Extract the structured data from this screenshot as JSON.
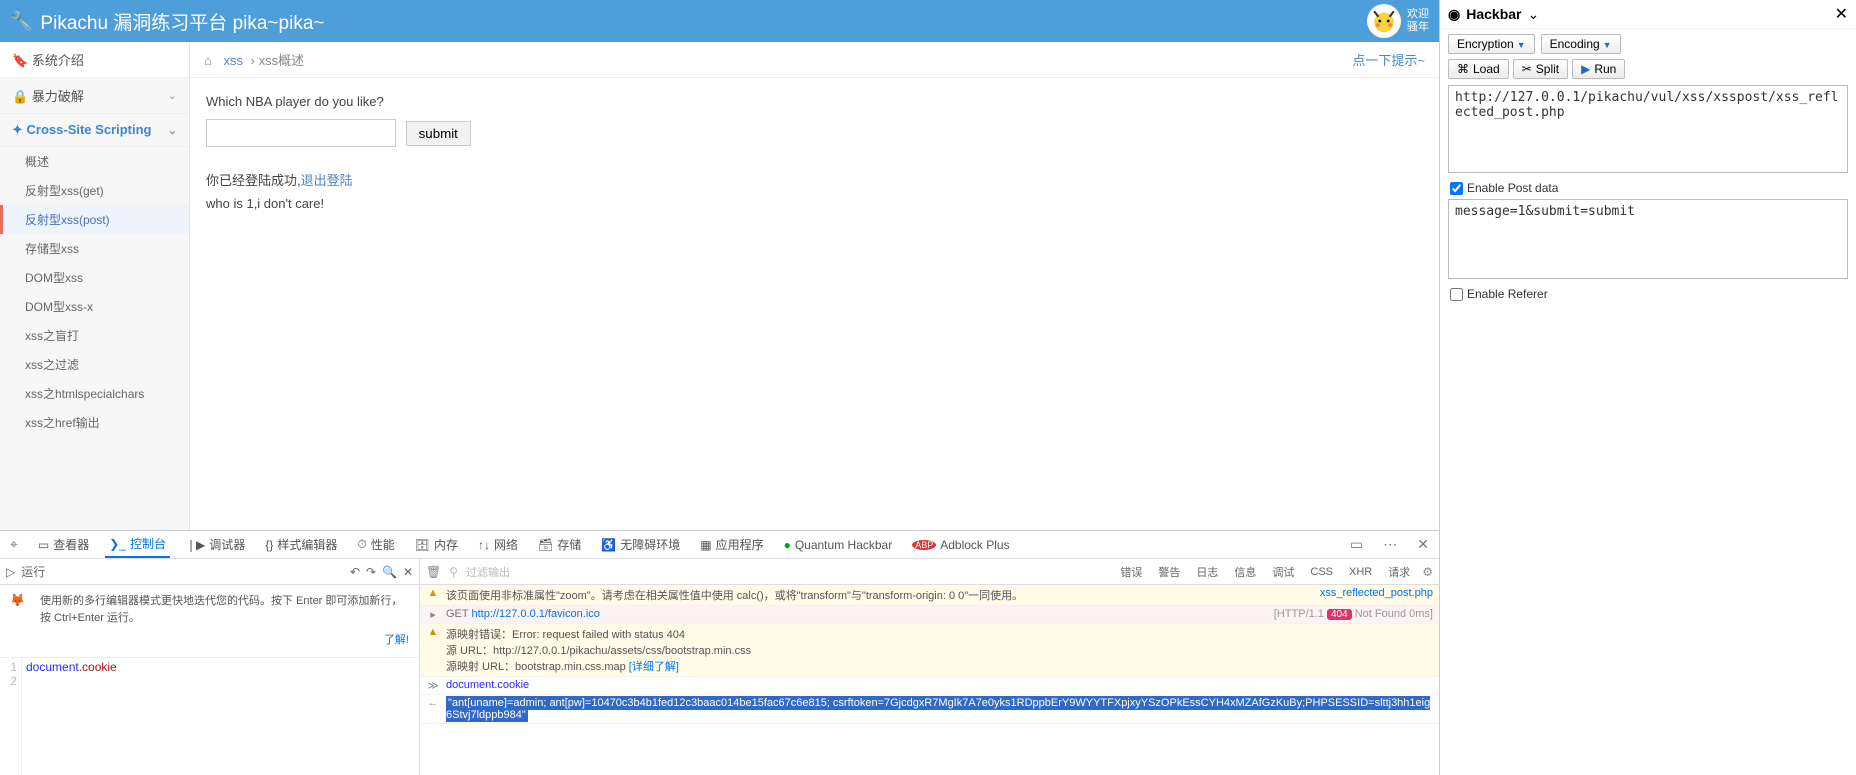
{
  "header": {
    "title": "Pikachu 漏洞练习平台 pika~pika~",
    "welcome_line1": "欢迎",
    "welcome_line2": "骚年"
  },
  "sidebar": {
    "intro": "系统介绍",
    "brute": "暴力破解",
    "xss_group": "Cross-Site Scripting",
    "items": [
      "概述",
      "反射型xss(get)",
      "反射型xss(post)",
      "存储型xss",
      "DOM型xss",
      "DOM型xss-x",
      "xss之盲打",
      "xss之过滤",
      "xss之htmlspecialchars",
      "xss之href输出"
    ]
  },
  "breadcrumb": {
    "root": "xss",
    "sep": "›",
    "leaf": "xss概述",
    "hint": "点一下提示~"
  },
  "content": {
    "question": "Which NBA player do you like?",
    "submit": "submit",
    "logged_prefix": "你已经登陆成功,",
    "logout_link": "退出登陆",
    "result_line": "who is 1,i don't care!"
  },
  "devtools": {
    "tabs": {
      "inspector": "查看器",
      "console": "控制台",
      "debugger": "调试器",
      "style": "样式编辑器",
      "perf": "性能",
      "memory": "内存",
      "network": "网络",
      "storage": "存储",
      "a11y": "无障碍环境",
      "app": "应用程序",
      "quantum": "Quantum Hackbar",
      "abp": "Adblock Plus"
    },
    "run_label": "运行",
    "editor_hint": "使用新的多行编辑器模式更快地迭代您的代码。按下 Enter 即可添加新行，按 Ctrl+Enter 运行。",
    "learn": "了解!",
    "editor_code_doc": "document",
    "editor_code_cookie": ".cookie",
    "filter_placeholder": "过滤输出",
    "pills": [
      "错误",
      "警告",
      "日志",
      "信息",
      "调试",
      "CSS",
      "XHR",
      "请求"
    ],
    "rows": {
      "warn1": "该页面使用非标准属性\"zoom\"。请考虑在相关属性值中使用 calc()，或将\"transform\"与\"transform-origin: 0 0\"一同使用。",
      "warn1_src": "xss_reflected_post.php",
      "err_prefix": "GET ",
      "err_url": "http://127.0.0.1/favicon.ico",
      "err_status_pre": "[HTTP/1.1 ",
      "err_code": "404",
      "err_status_post": " Not Found 0ms]",
      "warn2_l1": "源映射错误：Error: request failed with status 404",
      "warn2_l2": "源 URL：http://127.0.0.1/pikachu/assets/css/bootstrap.min.css",
      "warn2_l3_pre": "源映射 URL：bootstrap.min.css.map ",
      "warn2_l3_link": "[详细了解]",
      "input_expr": "document.cookie",
      "cookie_val": "\"ant[uname]=admin; ant[pw]=10470c3b4b1fed12c3baac014be15fac67c6e815; csrftoken=7GjcdgxR7MgIk7A7e0yks1RDppbErY9WYYTFXpjxyYSzOPkEssCYH4xMZAfGzKuBy;PHPSESSID=slttj3hh1eig6Stvj7ldppb984\""
    }
  },
  "hackbar": {
    "title": "Hackbar",
    "dropdowns": [
      "Encryption",
      "Encoding"
    ],
    "buttons": {
      "load": "Load",
      "split": "Split",
      "run": "Run"
    },
    "url": "http://127.0.0.1/pikachu/vul/xss/xsspost/xss_reflected_post.php",
    "enable_post": "Enable Post data",
    "post_data": "message=1&submit=submit",
    "enable_referer": "Enable Referer"
  }
}
